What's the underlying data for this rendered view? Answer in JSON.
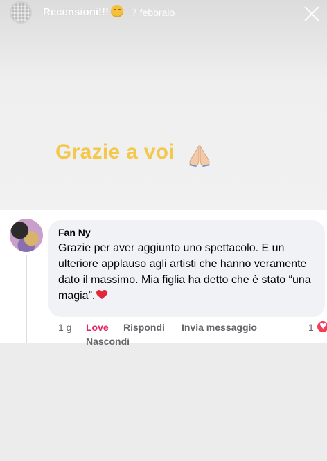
{
  "story": {
    "title": "Recensioni!!!",
    "date": "7 febbraio",
    "caption": "Grazie a voi",
    "icons": {
      "header_emoji": "relieved-face-icon",
      "caption_emoji": "folded-hands-icon",
      "close": "close-icon"
    }
  },
  "comment": {
    "author": "Fan Ny",
    "text": "Grazie per aver aggiunto uno spettacolo. E un ulteriore applauso agli artisti che hanno veramente dato il massimo. Mia figlia ha detto che è stato “una magia”.",
    "text_emoji": "red-heart-icon",
    "actions": {
      "time": "1 g",
      "love": "Love",
      "reply": "Rispondi",
      "message": "Invia messaggio",
      "hide": "Nascondi"
    },
    "reaction_count": "1",
    "reaction_icon": "love-reaction-icon"
  },
  "colors": {
    "caption": "#f4c84f",
    "love": "#e0245e",
    "bubble": "#f0f2f5"
  }
}
